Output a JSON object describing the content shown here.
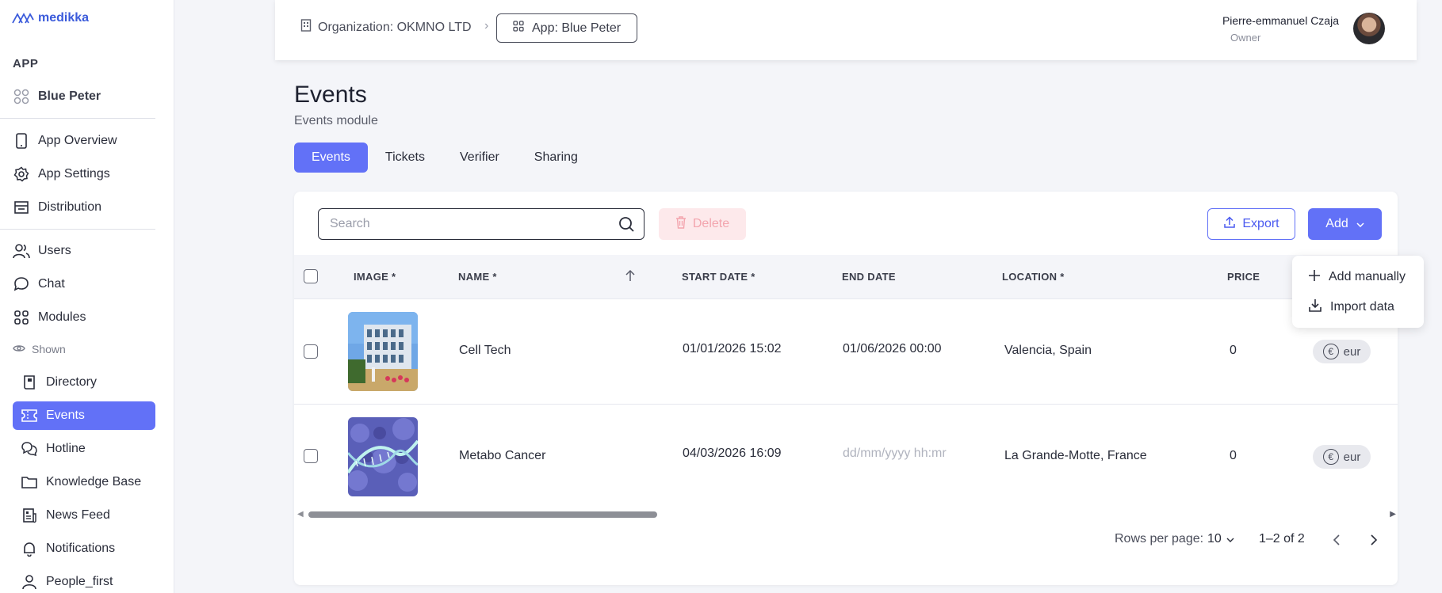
{
  "brand": {
    "name": "medikka",
    "color": "#3b5bdb"
  },
  "accent": "#6271f7",
  "sidebar": {
    "section_title": "APP",
    "app_name": "Blue Peter",
    "items": [
      {
        "label": "App Overview",
        "icon": "tablet-icon"
      },
      {
        "label": "App Settings",
        "icon": "gear-icon"
      },
      {
        "label": "Distribution",
        "icon": "store-icon"
      },
      {
        "label": "Users",
        "icon": "users-icon"
      },
      {
        "label": "Chat",
        "icon": "chat-icon"
      },
      {
        "label": "Modules",
        "icon": "grid-icon"
      }
    ],
    "shown_label": "Shown",
    "modules": [
      {
        "label": "Directory",
        "icon": "book-icon"
      },
      {
        "label": "Events",
        "icon": "ticket-icon",
        "active": true
      },
      {
        "label": "Hotline",
        "icon": "chat-bubbles-icon"
      },
      {
        "label": "Knowledge Base",
        "icon": "folder-icon"
      },
      {
        "label": "News Feed",
        "icon": "newspaper-icon"
      },
      {
        "label": "Notifications",
        "icon": "bell-icon"
      },
      {
        "label": "People_first",
        "icon": "person-icon"
      }
    ]
  },
  "header": {
    "org_label": "Organization: OKMNO LTD",
    "separator": "›",
    "app_label": "App: Blue Peter",
    "user_name": "Pierre-emmanuel Czaja",
    "user_role": "Owner"
  },
  "page": {
    "title": "Events",
    "subtitle": "Events module",
    "tabs": [
      "Events",
      "Tickets",
      "Verifier",
      "Sharing"
    ]
  },
  "toolbar": {
    "search_placeholder": "Search",
    "delete_label": "Delete",
    "export_label": "Export",
    "add_label": "Add"
  },
  "table": {
    "columns": [
      "IMAGE *",
      "NAME *",
      "START DATE *",
      "END DATE",
      "LOCATION *",
      "PRICE"
    ],
    "rows": [
      {
        "name": "Cell Tech",
        "start": "01/01/2026 15:02",
        "end": "01/06/2026 00:00",
        "end_placeholder": false,
        "location": "Valencia, Spain",
        "price": "0",
        "currency": "eur"
      },
      {
        "name": "Metabo Cancer",
        "start": "04/03/2026 16:09",
        "end": "dd/mm/yyyy hh:mr",
        "end_placeholder": true,
        "location": "La Grande-Motte, France",
        "price": "0",
        "currency": "eur"
      }
    ]
  },
  "pagination": {
    "rows_per_page_label": "Rows per page:",
    "rows_per_page": "10",
    "range": "1–2 of 2"
  },
  "add_menu": {
    "items": [
      {
        "label": "Add manually",
        "icon": "plus-icon"
      },
      {
        "label": "Import data",
        "icon": "download-icon"
      }
    ]
  }
}
